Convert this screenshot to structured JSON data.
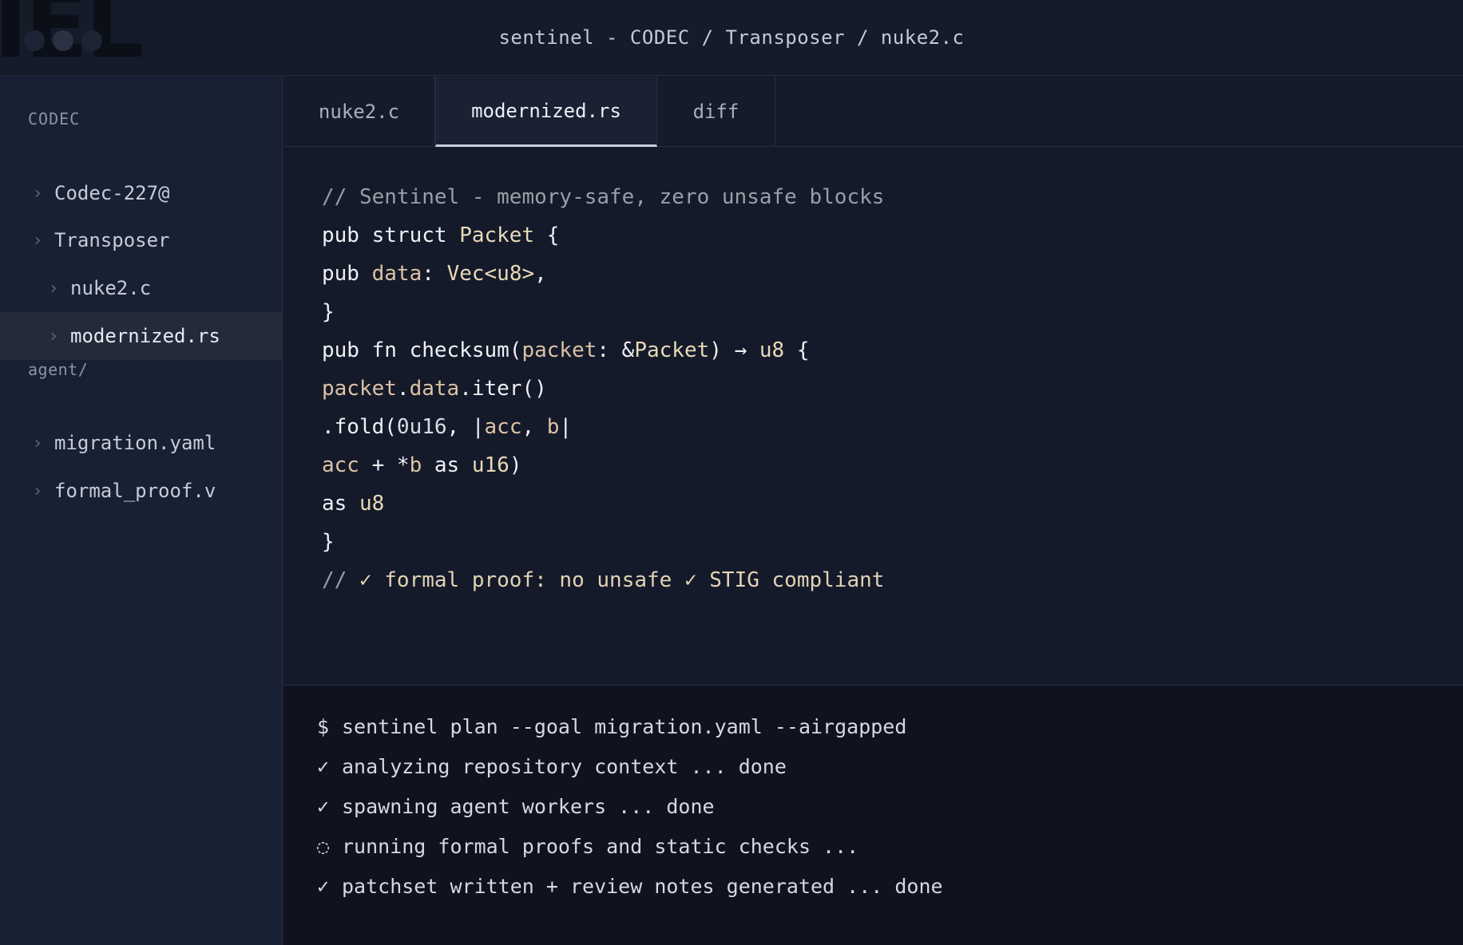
{
  "window": {
    "title": "sentinel - CODEC / Transposer / nuke2.c",
    "background_text": "IEL"
  },
  "sidebar": {
    "section1_label": "CODEC",
    "section1_items": [
      {
        "label": "Codec-227@"
      },
      {
        "label": "Transposer"
      },
      {
        "label": "nuke2.c"
      },
      {
        "label": "modernized.rs",
        "active": true
      }
    ],
    "section2_label": "agent/",
    "section2_items": [
      {
        "label": "migration.yaml"
      },
      {
        "label": "formal_proof.v"
      }
    ],
    "chevron_icon": "›"
  },
  "tabs": [
    {
      "label": "nuke2.c"
    },
    {
      "label": "modernized.rs",
      "active": true
    },
    {
      "label": "diff"
    }
  ],
  "editor": {
    "lines": [
      [
        {
          "t": "// Sentinel - memory-safe, zero unsafe blocks",
          "c": "com"
        }
      ],
      [
        {
          "t": "pub struct ",
          "c": "kw"
        },
        {
          "t": "Packet",
          "c": "type"
        },
        {
          "t": " {",
          "c": "kw"
        }
      ],
      [
        {
          "t": "pub ",
          "c": "kw"
        },
        {
          "t": "data",
          "c": "var"
        },
        {
          "t": ": ",
          "c": "kw"
        },
        {
          "t": "Vec<u8>",
          "c": "type"
        },
        {
          "t": ",",
          "c": "kw"
        }
      ],
      [
        {
          "t": "}",
          "c": "kw"
        }
      ],
      [
        {
          "t": "pub fn checksum(",
          "c": "kw"
        },
        {
          "t": "packet",
          "c": "var"
        },
        {
          "t": ": &",
          "c": "kw"
        },
        {
          "t": "Packet",
          "c": "type"
        },
        {
          "t": ") → ",
          "c": "kw"
        },
        {
          "t": "u8",
          "c": "type"
        },
        {
          "t": " {",
          "c": "kw"
        }
      ],
      [
        {
          "t": "packet",
          "c": "var"
        },
        {
          "t": ".",
          "c": "kw"
        },
        {
          "t": "data",
          "c": "var"
        },
        {
          "t": ".iter()",
          "c": "kw"
        }
      ],
      [
        {
          "t": ".fold(",
          "c": "kw"
        },
        {
          "t": "0u16",
          "c": "num"
        },
        {
          "t": ", |",
          "c": "kw"
        },
        {
          "t": "acc",
          "c": "var"
        },
        {
          "t": ", ",
          "c": "kw"
        },
        {
          "t": "b",
          "c": "var"
        },
        {
          "t": "|",
          "c": "kw"
        }
      ],
      [
        {
          "t": "acc",
          "c": "var"
        },
        {
          "t": " + *",
          "c": "kw"
        },
        {
          "t": "b",
          "c": "var"
        },
        {
          "t": " as ",
          "c": "kw"
        },
        {
          "t": "u16",
          "c": "type"
        },
        {
          "t": ")",
          "c": "kw"
        }
      ],
      [
        {
          "t": "as ",
          "c": "kw"
        },
        {
          "t": "u8",
          "c": "type"
        }
      ],
      [
        {
          "t": "}",
          "c": "kw"
        }
      ],
      [
        {
          "t": "// ",
          "c": "com"
        },
        {
          "t": "✓ formal proof: no unsafe ✓ STIG compliant",
          "c": "ok"
        }
      ]
    ]
  },
  "terminal": {
    "lines": [
      {
        "mark": "$",
        "text": "sentinel plan --goal migration.yaml --airgapped"
      },
      {
        "mark": "✓",
        "text": "analyzing repository context ... done"
      },
      {
        "mark": "✓",
        "text": "spawning agent workers ... done"
      },
      {
        "mark": "◌",
        "text": "running formal proofs and static checks ..."
      },
      {
        "mark": "✓",
        "text": "patchset written + review notes generated ... done"
      }
    ]
  }
}
